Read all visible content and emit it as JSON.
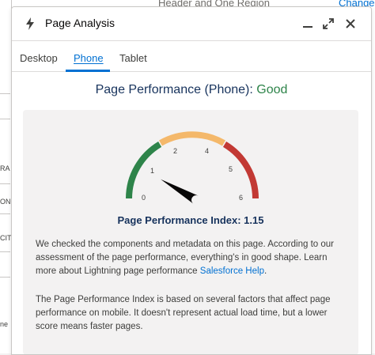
{
  "background": {
    "header_text": "Header and One Region",
    "change_link": "Change",
    "side_fragments": [
      "RA",
      "ON",
      "CIT",
      "ne"
    ]
  },
  "panel": {
    "title": "Page Analysis",
    "icons": {
      "app": "bolt-icon",
      "minimize": "minimize-icon",
      "expand": "expand-icon",
      "close": "close-icon"
    }
  },
  "tabs": [
    {
      "label": "Desktop",
      "active": false
    },
    {
      "label": "Phone",
      "active": true
    },
    {
      "label": "Tablet",
      "active": false
    }
  ],
  "performance": {
    "heading_prefix": "Page Performance (Phone): ",
    "rating": "Good",
    "gauge": {
      "ticks": [
        "0",
        "1",
        "2",
        "4",
        "5",
        "6"
      ],
      "value": 1.15,
      "colors": {
        "good": "#2e844a",
        "moderate": "#f4b86a",
        "poor": "#c23934",
        "needle": "#080707"
      }
    },
    "index_label": "Page Performance Index: 1.15",
    "paragraph1": "We checked the components and metadata on this page. According to our assessment of the page performance, everything's in good shape. Learn more about Lightning page performance ",
    "paragraph1_link": "Salesforce Help",
    "paragraph1_end": ".",
    "paragraph2": "The Page Performance Index is based on several factors that affect page performance on mobile. It doesn't represent actual load time, but a lower score means faster pages."
  }
}
